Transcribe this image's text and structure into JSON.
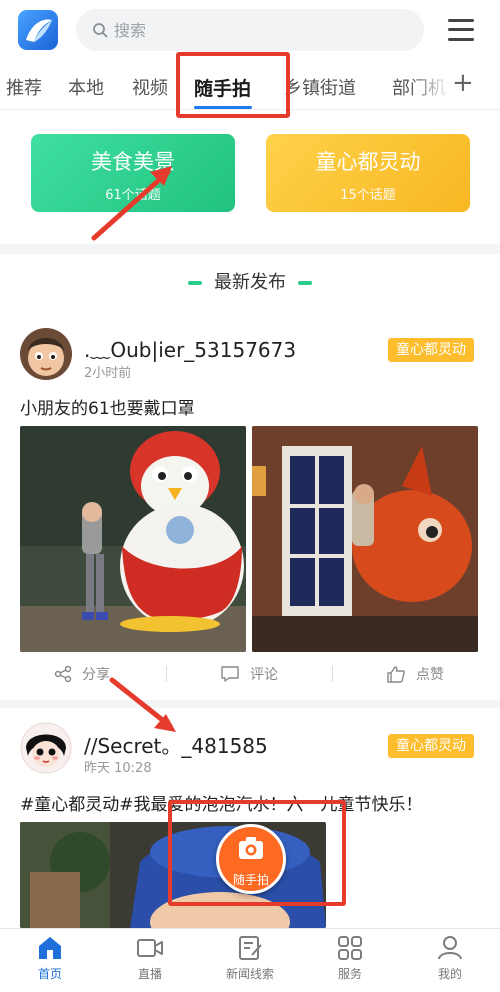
{
  "header": {
    "search_placeholder": "搜索"
  },
  "tabs": [
    {
      "label": "推荐"
    },
    {
      "label": "本地"
    },
    {
      "label": "视频"
    },
    {
      "label": "随手拍"
    },
    {
      "label": "乡镇街道"
    },
    {
      "label": "部门机"
    }
  ],
  "active_tab": "随手拍",
  "add_tab_symbol": "+",
  "topics": [
    {
      "title": "美食美景",
      "count": "61个话题",
      "color": "#26c986"
    },
    {
      "title": "童心都灵动",
      "count": "15个话题",
      "color": "#fbbf2b"
    }
  ],
  "section_title": "最新发布",
  "posts": [
    {
      "username": ".﹏Oub|ier_53157673",
      "time": "2小时前",
      "badge": "童心都灵动",
      "text": "小朋友的61也要戴口罩",
      "actions": {
        "share": "分享",
        "comment": "评论",
        "like": "点赞"
      }
    },
    {
      "username": "//Secret。_481585",
      "time": "昨天 10:28",
      "badge": "童心都灵动",
      "text": "#童心都灵动#我最爱的泡泡汽水！六一儿童节快乐！"
    }
  ],
  "fab_label": "随手拍",
  "bottom_nav": [
    {
      "label": "首页",
      "icon": "home-icon",
      "active": true
    },
    {
      "label": "直播",
      "icon": "video-camera-icon",
      "active": false
    },
    {
      "label": "新闻线索",
      "icon": "edit-doc-icon",
      "active": false
    },
    {
      "label": "服务",
      "icon": "grid-icon",
      "active": false
    },
    {
      "label": "我的",
      "icon": "user-icon",
      "active": false
    }
  ],
  "colors": {
    "accent_blue": "#1e7bf0",
    "annotation_red": "#e53b2c",
    "badge_yellow": "#fdbd2d",
    "fab_orange": "#ff6a22"
  }
}
